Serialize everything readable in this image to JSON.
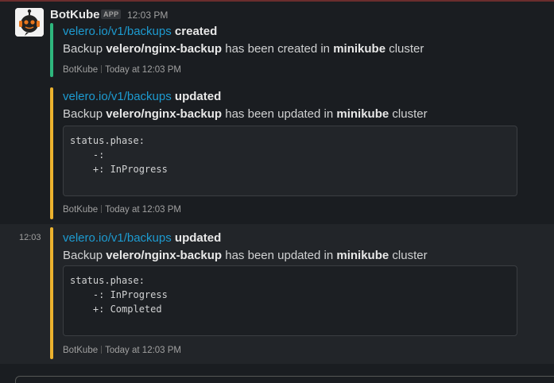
{
  "sender": "BotKube",
  "badge": "APP",
  "time_top": "12:03 PM",
  "messages": [
    {
      "link": "velero.io/v1/backups",
      "verb": "created",
      "text_pre": "Backup ",
      "resource": "velero/nginx-backup",
      "text_mid": " has been created in ",
      "cluster": "minikube",
      "text_post": " cluster",
      "code": "",
      "footer_app": "BotKube",
      "footer_time": "Today at 12:03 PM",
      "accent": "#2eb67d"
    },
    {
      "link": "velero.io/v1/backups",
      "verb": "updated",
      "text_pre": "Backup ",
      "resource": "velero/nginx-backup",
      "text_mid": " has been updated in ",
      "cluster": "minikube",
      "text_post": " cluster",
      "code": "status.phase:\n    -:\n    +: InProgress",
      "footer_app": "BotKube",
      "footer_time": "Today at 12:03 PM",
      "accent": "#ecb22e"
    },
    {
      "side_time": "12:03",
      "link": "velero.io/v1/backups",
      "verb": "updated",
      "text_pre": "Backup ",
      "resource": "velero/nginx-backup",
      "text_mid": " has been updated in ",
      "cluster": "minikube",
      "text_post": " cluster",
      "code": "status.phase:\n    -: InProgress\n    +: Completed",
      "footer_app": "BotKube",
      "footer_time": "Today at 12:03 PM",
      "accent": "#ecb22e"
    }
  ]
}
